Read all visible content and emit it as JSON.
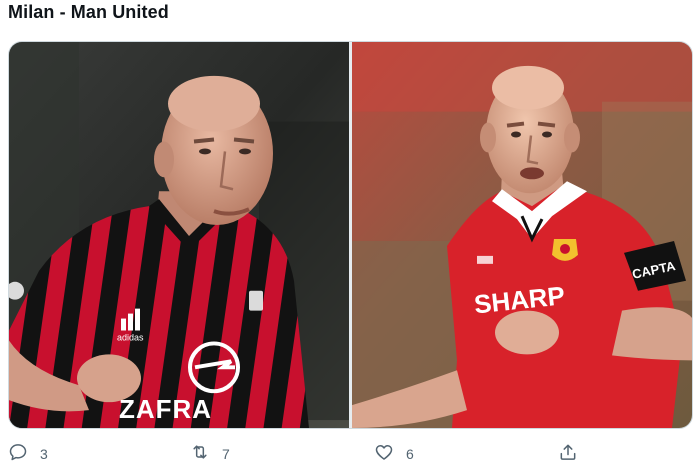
{
  "tweet": {
    "text": "Milan - Man United"
  },
  "media": {
    "left_photo": {
      "description_icon": "photo",
      "sponsor_text": "ZAFRA",
      "brand_text": "adidas"
    },
    "right_photo": {
      "description_icon": "photo",
      "sponsor_text": "SHARP",
      "armband_text": "CAPTA"
    }
  },
  "actions": {
    "reply": {
      "icon": "reply-icon",
      "count": "3"
    },
    "retweet": {
      "icon": "retweet-icon",
      "count": "7"
    },
    "like": {
      "icon": "heart-icon",
      "count": "6"
    },
    "share": {
      "icon": "share-icon",
      "count": ""
    }
  },
  "colors": {
    "milan_red": "#c8102e",
    "milan_black": "#111111",
    "united_red": "#d8222a",
    "icon_gray": "#536471"
  }
}
